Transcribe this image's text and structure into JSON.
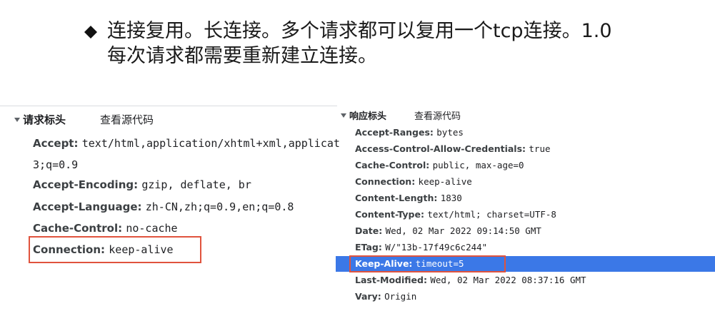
{
  "slide": {
    "line1": "连接复用。长连接。多个请求都可以复用一个tcp连接。1.0",
    "line2": "每次请求都需要重新建立连接。"
  },
  "request_headers": {
    "title": "请求标头",
    "view_source": "查看源代码",
    "rows": [
      {
        "key": "Accept:",
        "value": "text/html,application/xhtml+xml,applicat"
      },
      {
        "key": "",
        "value": "3;q=0.9"
      },
      {
        "key": "Accept-Encoding:",
        "value": "gzip, deflate, br"
      },
      {
        "key": "Accept-Language:",
        "value": "zh-CN,zh;q=0.9,en;q=0.8"
      },
      {
        "key": "Cache-Control:",
        "value": "no-cache"
      },
      {
        "key": "Connection:",
        "value": "keep-alive"
      }
    ]
  },
  "response_headers": {
    "title": "响应标头",
    "view_source": "查看源代码",
    "rows": [
      {
        "key": "Accept-Ranges:",
        "value": "bytes"
      },
      {
        "key": "Access-Control-Allow-Credentials:",
        "value": "true"
      },
      {
        "key": "Cache-Control:",
        "value": "public, max-age=0"
      },
      {
        "key": "Connection:",
        "value": "keep-alive"
      },
      {
        "key": "Content-Length:",
        "value": "1830"
      },
      {
        "key": "Content-Type:",
        "value": "text/html; charset=UTF-8"
      },
      {
        "key": "Date:",
        "value": "Wed, 02 Mar 2022 09:14:50 GMT"
      },
      {
        "key": "ETag:",
        "value": "W/\"13b-17f49c6c244\""
      },
      {
        "key": "Keep-Alive:",
        "value": "timeout=5"
      },
      {
        "key": "Last-Modified:",
        "value": "Wed, 02 Mar 2022 08:37:16 GMT"
      },
      {
        "key": "Vary:",
        "value": "Origin"
      }
    ]
  },
  "colors": {
    "highlight_row": "#3b78e7",
    "annotation_box": "#e0533d"
  }
}
